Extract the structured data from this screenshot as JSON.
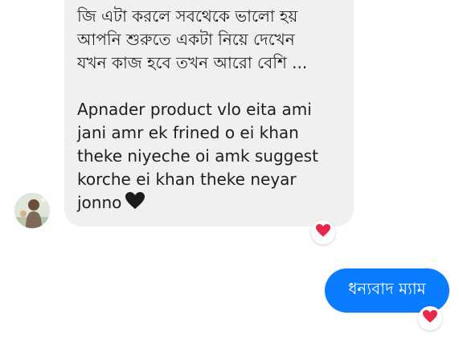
{
  "colors": {
    "incoming_bubble": "#f0f0f0",
    "outgoing_bubble": "#0a7cff",
    "reaction_heart": "#e8284b",
    "text_dark": "#1c1e21"
  },
  "messages": [
    {
      "direction": "incoming",
      "lines": [
        "জি  এটা করলে সবথেকে ভালো হয়",
        "আপনি শুরুতে একটা নিয়ে দেখেন",
        "যখন কাজ হবে তখন আরো বেশি ...",
        "",
        "Apnader product vlo eita ami",
        "jani amr ek frined o ei khan",
        "theke niyeche oi amk suggest",
        "korche ei khan theke neyar",
        "jonno"
      ],
      "trailing_icon": "black-heart-icon",
      "reaction": "heart-icon"
    },
    {
      "direction": "outgoing",
      "text": "ধন্যবাদ ম্যাম",
      "reaction": "heart-icon"
    }
  ]
}
